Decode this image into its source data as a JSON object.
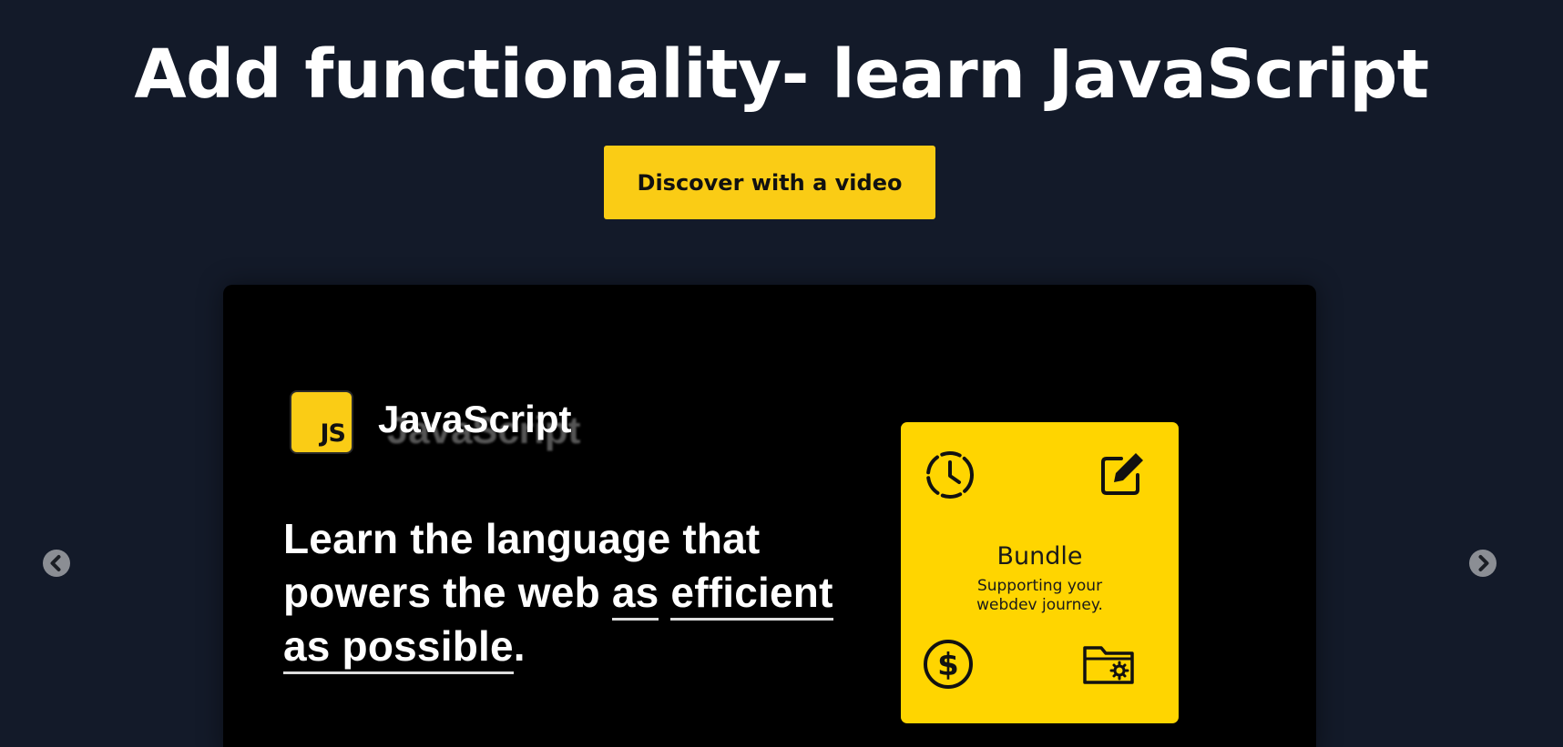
{
  "hero": {
    "title": "Add functionality- learn JavaScript",
    "cta_label": "Discover with a video"
  },
  "slide": {
    "logo_text": "JS",
    "brand_name": "JavaScript",
    "tagline_plain": "Learn the language that powers the web ",
    "tagline_underlined_1": "as",
    "tagline_underlined_2": "efficient as possible",
    "tagline_end": ".",
    "bundle": {
      "title": "Bundle",
      "subtitle": "Supporting your webdev journey.",
      "icons": [
        "clock-icon",
        "edit-icon",
        "dollar-icon",
        "folder-settings-icon"
      ]
    }
  },
  "colors": {
    "background": "#131a29",
    "accent": "#facc15",
    "card": "#ffd500",
    "slide_background": "#000000"
  },
  "carousel": {
    "prev_icon": "chevron-left-icon",
    "next_icon": "chevron-right-icon"
  }
}
